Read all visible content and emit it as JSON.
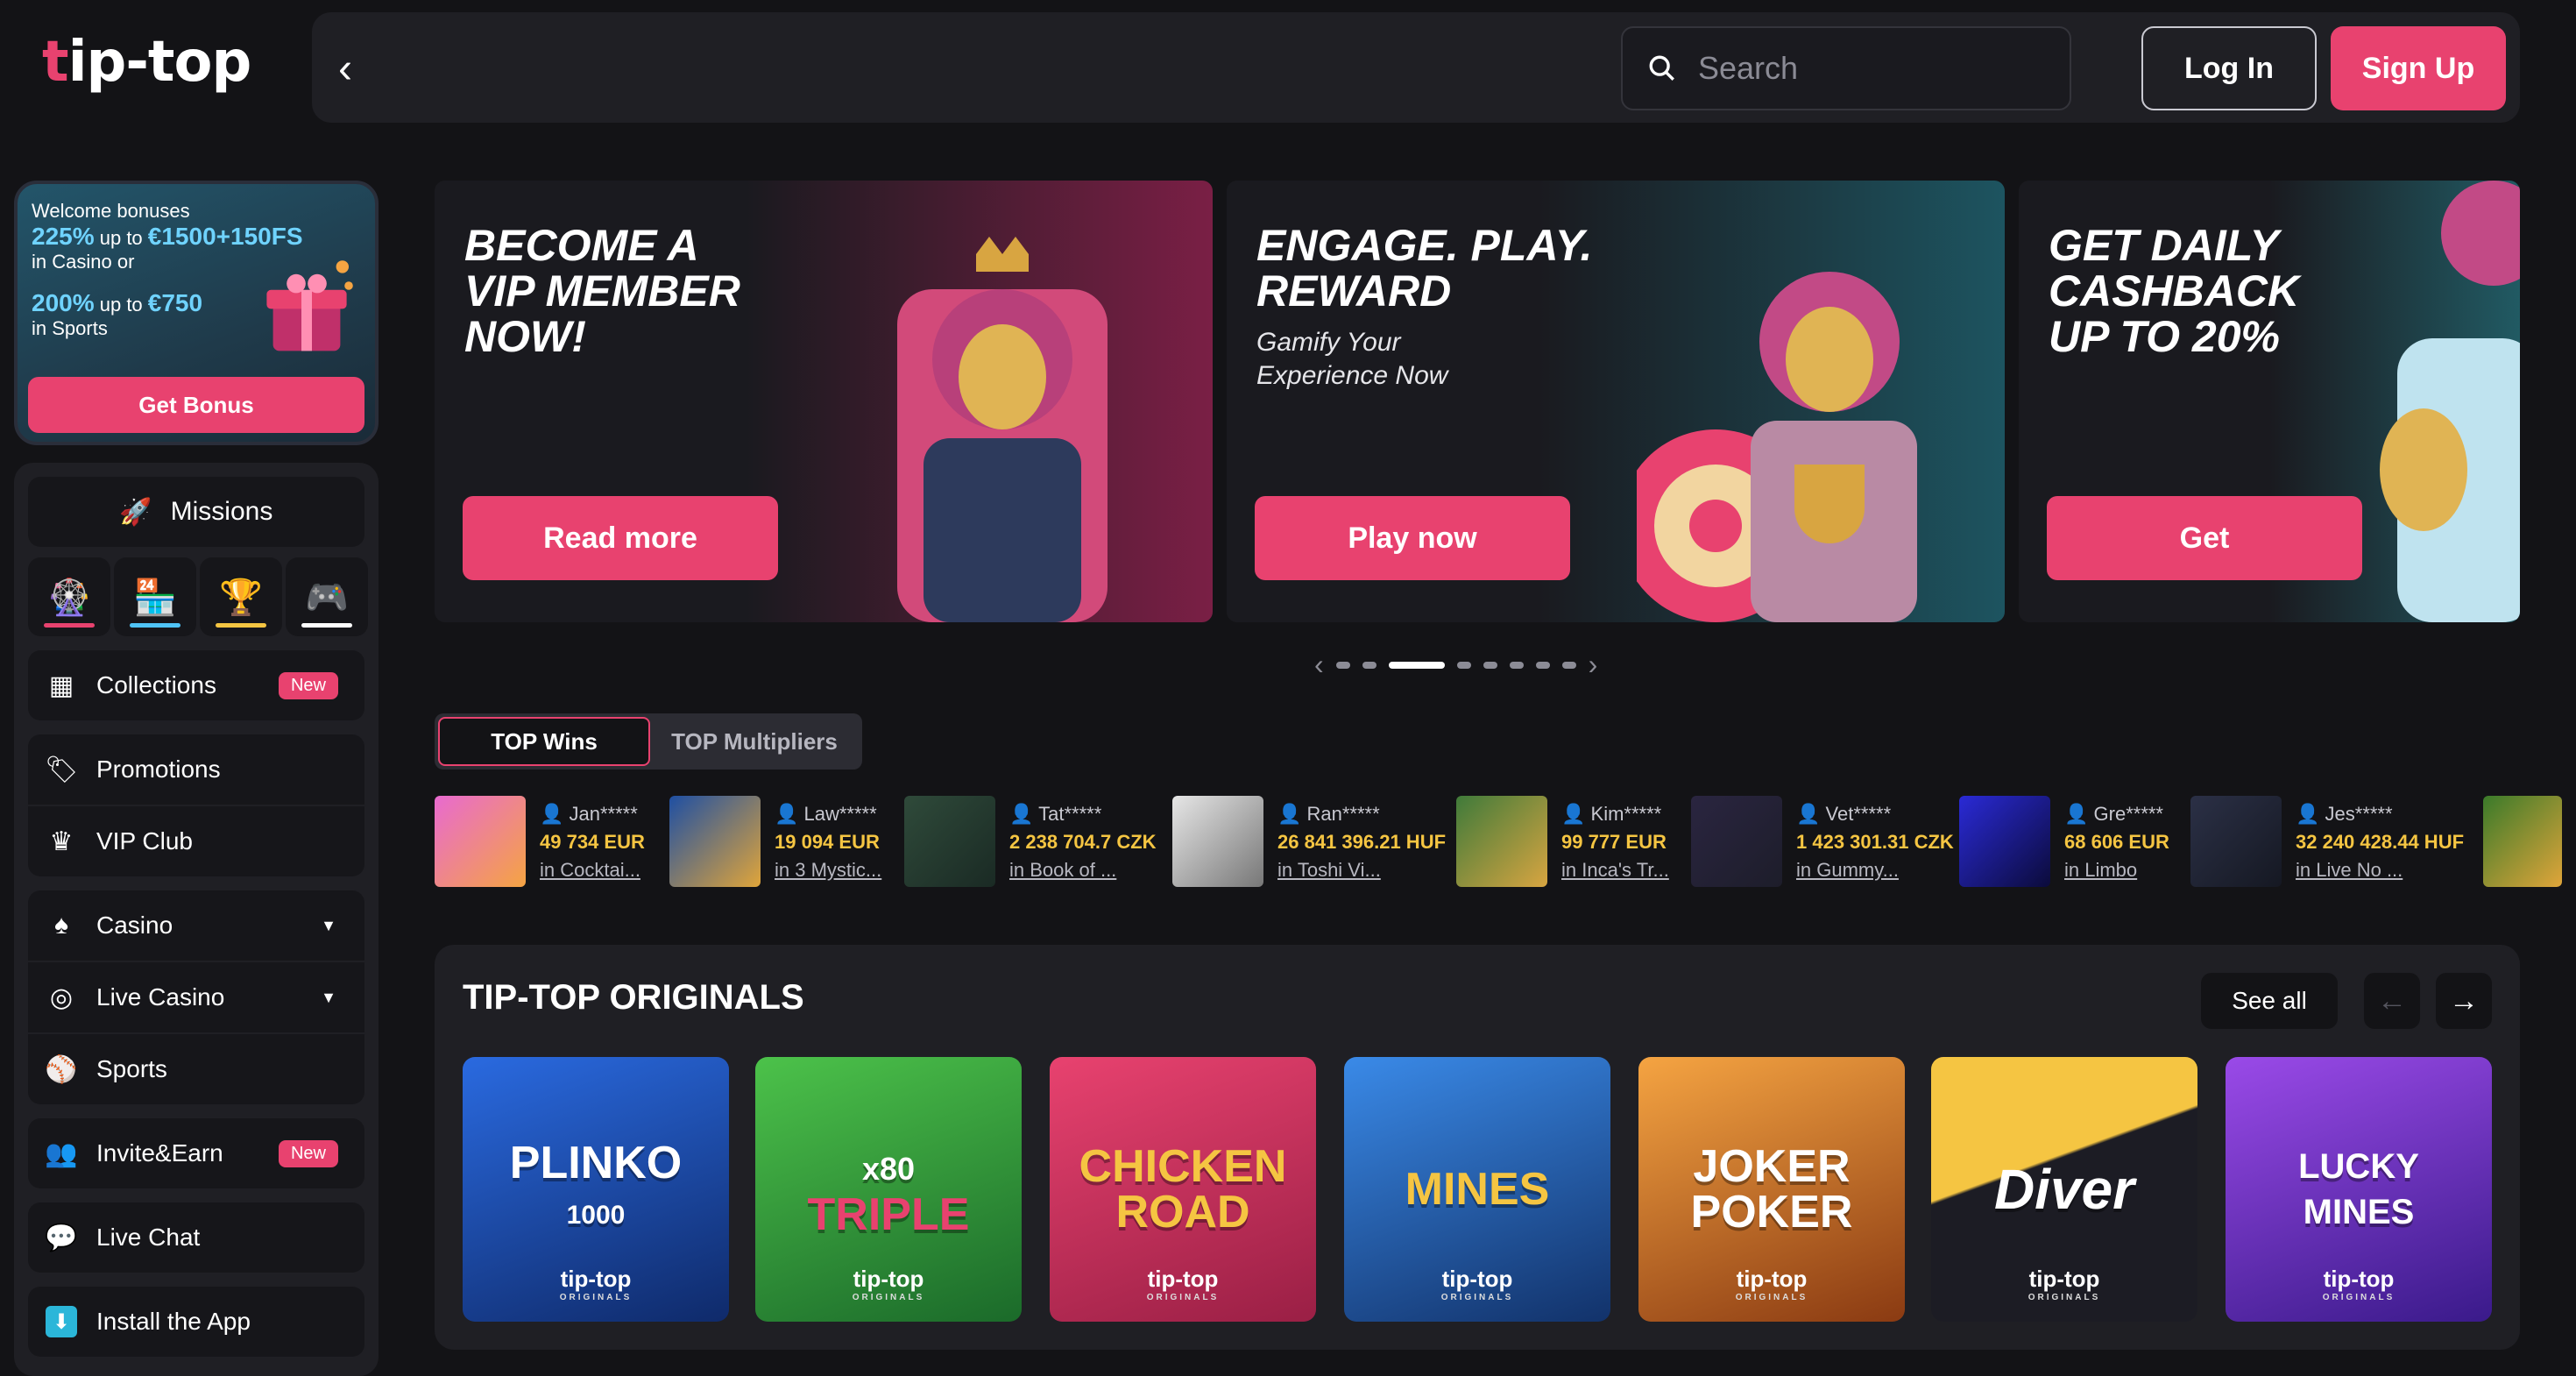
{
  "brand": {
    "logo_t": "t",
    "logo_rest": "ip-top"
  },
  "header": {
    "search_placeholder": "Search",
    "login": "Log In",
    "signup": "Sign Up"
  },
  "sidebar": {
    "bonus": {
      "line1": "Welcome bonuses",
      "casino_pct": "225%",
      "casino_upto": " up to ",
      "casino_amount": "€1500+150FS",
      "casino_suffix": "in Casino or",
      "sports_pct": "200%",
      "sports_upto": " up to ",
      "sports_amount": "€750",
      "sports_suffix": "in Sports",
      "button": "Get Bonus"
    },
    "missions": "Missions",
    "items": [
      {
        "label": "Collections",
        "badge": "New"
      },
      {
        "label": "Promotions"
      },
      {
        "label": "VIP Club"
      },
      {
        "label": "Casino"
      },
      {
        "label": "Live Casino"
      },
      {
        "label": "Sports"
      },
      {
        "label": "Invite&Earn",
        "badge": "New"
      },
      {
        "label": "Live Chat"
      },
      {
        "label": "Install the App"
      }
    ]
  },
  "banners": [
    {
      "title1": "BECOME A",
      "title2": "VIP MEMBER",
      "title3": "NOW!",
      "sub1": "",
      "sub2": "",
      "button": "Read more"
    },
    {
      "title1": "ENGAGE. PLAY.",
      "title2": "REWARD",
      "title3": "",
      "sub1": "Gamify Your",
      "sub2": "Experience Now",
      "button": "Play now"
    },
    {
      "title1": "GET DAILY",
      "title2": "CASHBACK",
      "title3": "UP TO 20%",
      "sub1": "",
      "sub2": "",
      "button": "Get"
    }
  ],
  "wins_tabs": {
    "top_wins": "TOP Wins",
    "top_multipliers": "TOP Multipliers"
  },
  "wins": [
    {
      "user": "Jan*****",
      "amount": "49 734 EUR",
      "game": "in Cocktai..."
    },
    {
      "user": "Law*****",
      "amount": "19 094 EUR",
      "game": "in 3 Mystic..."
    },
    {
      "user": "Tat*****",
      "amount": "2 238 704.7 CZK",
      "game": "in Book of ..."
    },
    {
      "user": "Ran*****",
      "amount": "26 841 396.21 HUF",
      "game": "in Toshi Vi..."
    },
    {
      "user": "Kim*****",
      "amount": "99 777 EUR",
      "game": "in Inca's Tr..."
    },
    {
      "user": "Vet*****",
      "amount": "1 423 301.31 CZK",
      "game": "in Gummy..."
    },
    {
      "user": "Gre*****",
      "amount": "68 606 EUR",
      "game": "in Limbo"
    },
    {
      "user": "Jes*****",
      "amount": "32 240 428.44 HUF",
      "game": "in Live No ..."
    }
  ],
  "originals": {
    "title": "TIP-TOP ORIGINALS",
    "see_all": "See all",
    "cards": [
      {
        "name": "PLINKO",
        "name2": "1000"
      },
      {
        "name": "TRIPLE",
        "name2": "x80"
      },
      {
        "name": "CHICKEN",
        "name2": "ROAD"
      },
      {
        "name": "MINES",
        "name2": ""
      },
      {
        "name": "JOKER",
        "name2": "POKER"
      },
      {
        "name": "Diver",
        "name2": ""
      },
      {
        "name": "LUCKY",
        "name2": "MINES"
      }
    ],
    "card_brand": "tip-top",
    "card_brand_sub": "ORIGINALS"
  },
  "colors": {
    "accent": "#e8426f",
    "bg": "#131316",
    "panel": "#1f1f24",
    "amount": "#f5c542"
  }
}
